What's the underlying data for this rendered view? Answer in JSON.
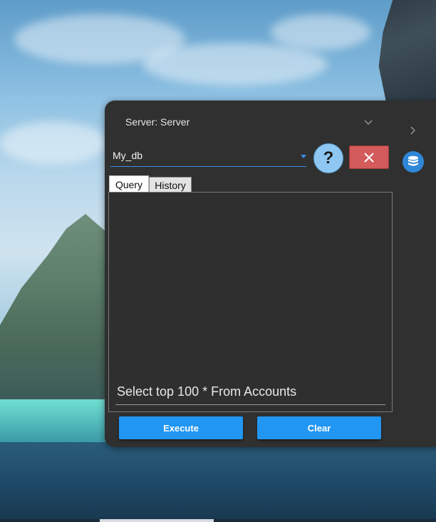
{
  "server": {
    "label": "Server: Server"
  },
  "database": {
    "value": "My_db"
  },
  "help": {
    "glyph": "?"
  },
  "close": {
    "glyph": "✕"
  },
  "tabs": [
    {
      "label": "Query"
    },
    {
      "label": "History"
    }
  ],
  "query": {
    "text": "Select top 100 * From Accounts"
  },
  "buttons": {
    "execute": "Execute",
    "clear": "Clear"
  },
  "colors": {
    "accent": "#2196f3",
    "danger": "#d35b5b",
    "panel": "#303030"
  }
}
